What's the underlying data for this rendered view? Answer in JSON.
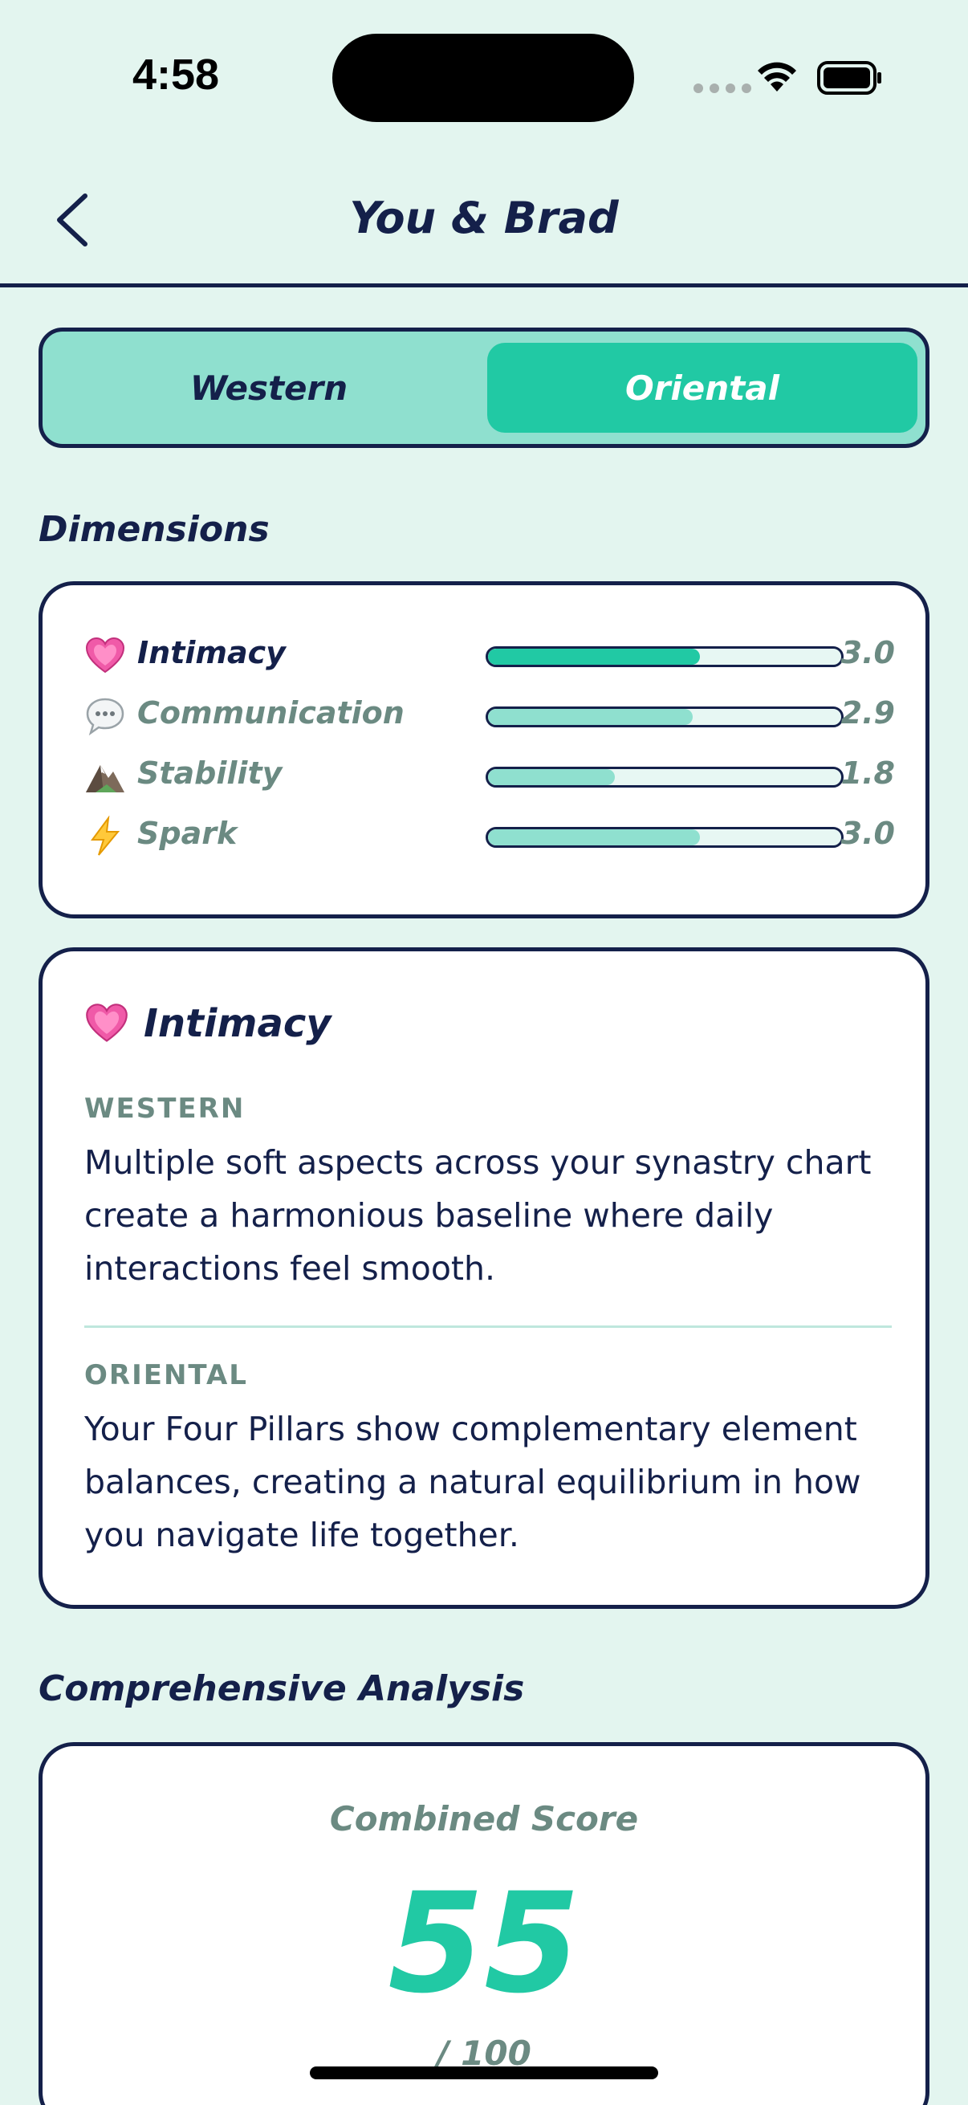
{
  "status": {
    "time": "4:58"
  },
  "header": {
    "title": "You & Brad"
  },
  "segment": {
    "options": [
      "Western",
      "Oriental"
    ],
    "selected": "Oriental"
  },
  "dimensions": {
    "heading": "Dimensions",
    "items": [
      {
        "label": "Intimacy",
        "value": "3.0",
        "fill": 0.6,
        "icon": "heart-icon",
        "active": true
      },
      {
        "label": "Communication",
        "value": "2.9",
        "fill": 0.58,
        "icon": "speech-bubble-icon",
        "active": false
      },
      {
        "label": "Stability",
        "value": "1.8",
        "fill": 0.36,
        "icon": "mountain-icon",
        "active": false
      },
      {
        "label": "Spark",
        "value": "3.0",
        "fill": 0.6,
        "icon": "lightning-icon",
        "active": false
      }
    ]
  },
  "detail": {
    "title": "Intimacy",
    "western_label": "WESTERN",
    "western_text": "Multiple soft aspects across your synastry chart create a harmonious baseline where daily interactions feel smooth.",
    "oriental_label": "ORIENTAL",
    "oriental_text": "Your Four Pillars show complementary element balances, creating a natural equilibrium in how you navigate life together."
  },
  "analysis": {
    "heading": "Comprehensive Analysis",
    "combined_label": "Combined Score",
    "score": "55",
    "max": "/ 100"
  },
  "colors": {
    "accent": "#21c9a4",
    "accent_light": "#8fe0cf",
    "ink": "#14204a",
    "muted": "#6b8a82",
    "bg": "#e3f5ef"
  }
}
